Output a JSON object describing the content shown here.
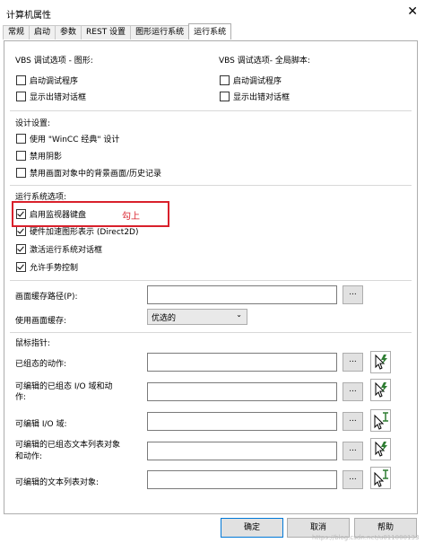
{
  "window": {
    "title": "计算机属性",
    "close_glyph": "✕"
  },
  "tabs": [
    {
      "label": "常规"
    },
    {
      "label": "启动"
    },
    {
      "label": "参数"
    },
    {
      "label": "REST 设置"
    },
    {
      "label": "图形运行系统"
    },
    {
      "label": "运行系统"
    }
  ],
  "vbs_graphics": {
    "heading": "VBS 调试选项 - 图形:",
    "start_debugger": {
      "label": "启动调试程序",
      "checked": false
    },
    "show_error_dialog": {
      "label": "显示出错对话框",
      "checked": false
    }
  },
  "vbs_global": {
    "heading": "VBS 调试选项- 全局脚本:",
    "start_debugger": {
      "label": "启动调试程序",
      "checked": false
    },
    "show_error_dialog": {
      "label": "显示出错对话框",
      "checked": false
    }
  },
  "design": {
    "heading": "设计设置:",
    "classic": {
      "label": "使用 \"WinCC 经典\" 设计",
      "checked": false
    },
    "shadow": {
      "label": "禁用阴影",
      "checked": false
    },
    "background": {
      "label": "禁用画面对象中的背景画面/历史记录",
      "checked": false
    }
  },
  "runtime": {
    "heading": "运行系统选项:",
    "monitor_keyboard": {
      "label": "启用监视器键盘",
      "checked": true
    },
    "hw_accel": {
      "label": "硬件加速图形表示 (Direct2D)",
      "checked": true
    },
    "activate_dialog": {
      "label": "激活运行系统对话框",
      "checked": true
    },
    "gesture": {
      "label": "允许手势控制",
      "checked": true
    }
  },
  "annotation": {
    "text": "勾上",
    "color": "#d9202b"
  },
  "cache": {
    "path_label": "画面缓存路径(P):",
    "path_value": "",
    "use_label": "使用画面缓存:",
    "use_value": "优选的"
  },
  "pointer": {
    "heading": "鼠标指针:",
    "rows": [
      {
        "label": "已组态的动作:",
        "value": "",
        "icon": "arrow-lightning-cursor-icon"
      },
      {
        "label": "可编辑的已组态 I/O 域和动作:",
        "label_line1": "可编辑的已组态 I/O 域和动",
        "label_line2": "作:",
        "value": "",
        "icon": "arrow-lightning-cursor-icon"
      },
      {
        "label": "可编辑 I/O 域:",
        "value": "",
        "icon": "arrow-ibeam-cursor-icon"
      },
      {
        "label": "可编辑的已组态文本列表对象和动作:",
        "label_line1": "可编辑的已组态文本列表对象",
        "label_line2": "和动作:",
        "value": "",
        "icon": "arrow-lightning-cursor-icon"
      },
      {
        "label": "可编辑的文本列表对象:",
        "value": "",
        "icon": "arrow-ibeam-cursor-icon"
      }
    ]
  },
  "browse_label": "...",
  "footer": {
    "ok": "确定",
    "cancel": "取消",
    "help": "帮助"
  },
  "watermark": "https://blog.csdn.net/u011000133",
  "colors": {
    "accent": "#0078d7",
    "annotation_red": "#d9202b",
    "cursor_green": "#2e7d32"
  }
}
